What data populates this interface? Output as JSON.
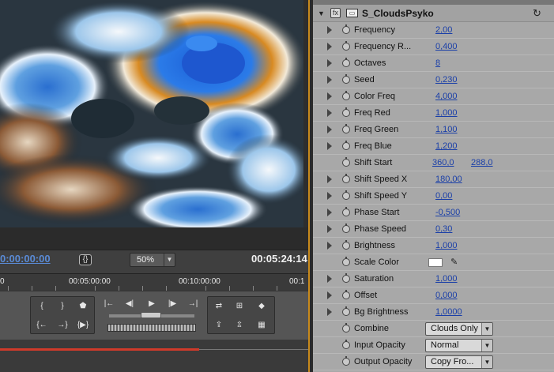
{
  "monitor": {
    "timecode_current": "0:00:00:00",
    "frame_icon": "{}",
    "zoom": "50%",
    "timecode_duration": "00:05:24:14",
    "ruler_labels": [
      "0",
      "00:05:00:00",
      "00:10:00:00",
      "00:1"
    ],
    "transport": {
      "mark_in_icon": "{",
      "mark_out_icon": "}",
      "marker_icon": "marker",
      "go_in_icon": "{←",
      "go_out_icon": "→}",
      "play_in_out_icon": "{▶}",
      "step_back_icon": "|←",
      "rewind_icon": "◀|",
      "play_icon": "▶",
      "forward_icon": "|▶",
      "step_fwd_icon": "→|",
      "loop_icon": "loop",
      "safe_margins_icon": "safe-margins",
      "output_icon": "output",
      "lift_icon": "lift",
      "extract_icon": "extract",
      "export_frame_icon": "export-frame"
    }
  },
  "effect": {
    "name": "S_CloudsPsyko",
    "collapse_icon": "▼",
    "toggle_icon": "fx",
    "layer_icon": "fx-layer",
    "reset_icon": "↻",
    "params": [
      {
        "label": "Frequency",
        "value": "2,00",
        "twirl": true
      },
      {
        "label": "Frequency R...",
        "value": "0,400",
        "twirl": true
      },
      {
        "label": "Octaves",
        "value": "8",
        "twirl": true
      },
      {
        "label": "Seed",
        "value": "0,230",
        "twirl": true
      },
      {
        "label": "Color Freq",
        "value": "4,000",
        "twirl": true
      },
      {
        "label": "Freq Red",
        "value": "1,000",
        "twirl": true
      },
      {
        "label": "Freq Green",
        "value": "1,100",
        "twirl": true
      },
      {
        "label": "Freq Blue",
        "value": "1,200",
        "twirl": true
      },
      {
        "label": "Shift Start",
        "value": "360,0",
        "value2": "288,0",
        "twirl": false
      },
      {
        "label": "Shift Speed X",
        "value": "180,00",
        "twirl": true
      },
      {
        "label": "Shift Speed Y",
        "value": "0,00",
        "twirl": true
      },
      {
        "label": "Phase Start",
        "value": "-0,500",
        "twirl": true
      },
      {
        "label": "Phase Speed",
        "value": "0,30",
        "twirl": true
      },
      {
        "label": "Brightness",
        "value": "1,000",
        "twirl": true
      },
      {
        "label": "Scale Color",
        "color": "#ffffff",
        "twirl": false
      },
      {
        "label": "Saturation",
        "value": "1,000",
        "twirl": true
      },
      {
        "label": "Offset",
        "value": "0,000",
        "twirl": true
      },
      {
        "label": "Bg Brightness",
        "value": "1,0000",
        "twirl": true
      },
      {
        "label": "Combine",
        "dropdown": "Clouds Only",
        "twirl": false
      },
      {
        "label": "Input Opacity",
        "dropdown": "Normal",
        "twirl": false
      },
      {
        "label": "Output Opacity",
        "dropdown": "Copy Fro...",
        "twirl": false
      }
    ]
  },
  "colors": {
    "accent_orange": "#c88a1c",
    "timecode_blue": "#5a8bd6",
    "value_blue": "#1a3fa8",
    "timeline_red": "#d03a2a"
  }
}
